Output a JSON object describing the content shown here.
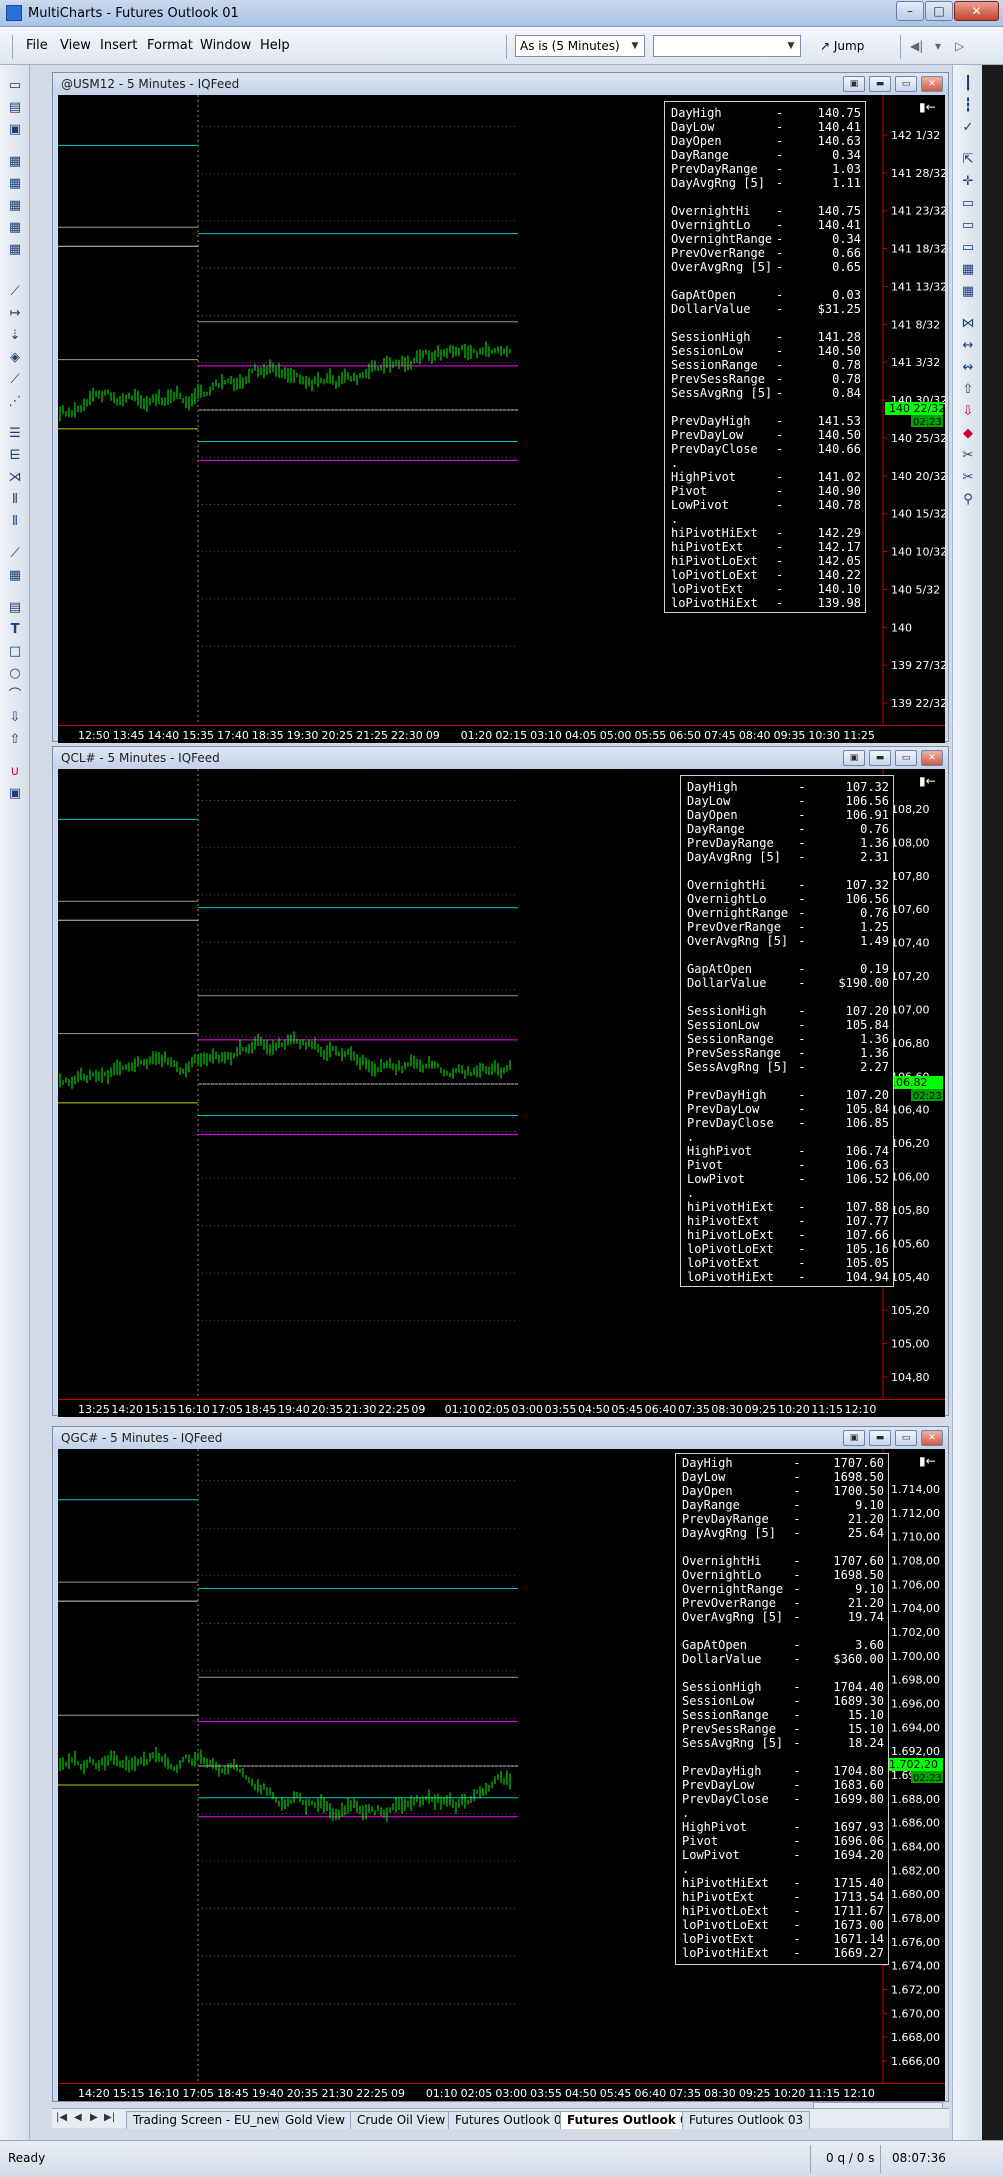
{
  "window": {
    "title": "MultiCharts - Futures Outlook 01",
    "buttons": {
      "minimize": "–",
      "maximize": "□",
      "close": "✕"
    }
  },
  "menu": [
    "File",
    "View",
    "Insert",
    "Format",
    "Window",
    "Help"
  ],
  "toolbar": {
    "resolution": "As is (5 Minutes)",
    "search_value": "",
    "jump_label": "Jump"
  },
  "colors": {
    "background": "#000000",
    "price": "#00ff00",
    "session": "#00c8c8",
    "pivot": "#ff00ff",
    "current_price_bg": "#00ff00"
  },
  "charts": [
    {
      "title": "@USM12 - 5 Minutes - IQFeed",
      "current_price": "140 22/32",
      "countdown": "02:23",
      "price_labels": [
        "142 1/32",
        "141 28/32",
        "141 23/32",
        "141 18/32",
        "141 13/32",
        "141 8/32",
        "141 3/32",
        "140 30/32",
        "140 25/32",
        "140 20/32",
        "140 15/32",
        "140 10/32",
        "140 5/32",
        "140",
        "139 27/32",
        "139 22/32"
      ],
      "time_labels": [
        "12:50",
        "13:45",
        "14:40",
        "15:35",
        "17:40",
        "18:35",
        "19:30",
        "20:25",
        "21:25",
        "22:30",
        "09",
        "01:20",
        "02:15",
        "03:10",
        "04:05",
        "05:00",
        "05:55",
        "06:50",
        "07:45",
        "08:40",
        "09:35",
        "10:30",
        "11:25"
      ],
      "stats": [
        [
          "DayHigh",
          "-",
          "140.75"
        ],
        [
          "DayLow",
          "-",
          "140.41"
        ],
        [
          "DayOpen",
          "-",
          "140.63"
        ],
        [
          "DayRange",
          "-",
          "0.34"
        ],
        [
          "PrevDayRange",
          "-",
          "1.03"
        ],
        [
          "DayAvgRng [5]",
          "-",
          "1.11"
        ],
        [
          "",
          "",
          ""
        ],
        [
          "OvernightHi",
          "-",
          "140.75"
        ],
        [
          "OvernightLo",
          "-",
          "140.41"
        ],
        [
          "OvernightRange",
          "-",
          "0.34"
        ],
        [
          "PrevOverRange",
          "-",
          "0.66"
        ],
        [
          "OverAvgRng [5]",
          "-",
          "0.65"
        ],
        [
          "",
          "",
          ""
        ],
        [
          "GapAtOpen",
          "-",
          "0.03"
        ],
        [
          "DollarValue",
          "-",
          "$31.25"
        ],
        [
          "",
          "",
          ""
        ],
        [
          "SessionHigh",
          "-",
          "141.28"
        ],
        [
          "SessionLow",
          "-",
          "140.50"
        ],
        [
          "SessionRange",
          "-",
          "0.78"
        ],
        [
          "PrevSessRange",
          "-",
          "0.78"
        ],
        [
          "SessAvgRng [5]",
          "-",
          "0.84"
        ],
        [
          "",
          "",
          ""
        ],
        [
          "PrevDayHigh",
          "-",
          "141.53"
        ],
        [
          "PrevDayLow",
          "-",
          "140.50"
        ],
        [
          "PrevDayClose",
          "-",
          "140.66"
        ],
        [
          ".",
          "",
          ""
        ],
        [
          "HighPivot",
          "-",
          "141.02"
        ],
        [
          "Pivot",
          "-",
          "140.90"
        ],
        [
          "LowPivot",
          "-",
          "140.78"
        ],
        [
          ".",
          "",
          ""
        ],
        [
          "hiPivotHiExt",
          "-",
          "142.29"
        ],
        [
          "hiPivotExt",
          "-",
          "142.17"
        ],
        [
          "hiPivotLoExt",
          "-",
          "142.05"
        ],
        [
          "loPivotLoExt",
          "-",
          "140.22"
        ],
        [
          "loPivotExt",
          "-",
          "140.10"
        ],
        [
          "loPivotHiExt",
          "-",
          "139.98"
        ]
      ]
    },
    {
      "title": "QCL# - 5 Minutes - IQFeed",
      "current_price": "106.82",
      "countdown": "02:23",
      "price_labels": [
        "108,20",
        "108,00",
        "107,80",
        "107,60",
        "107,40",
        "107,20",
        "107,00",
        "106,80",
        "106,60",
        "106,40",
        "106,20",
        "106,00",
        "105,80",
        "105,60",
        "105,40",
        "105,20",
        "105,00",
        "104,80"
      ],
      "time_labels": [
        "13:25",
        "14:20",
        "15:15",
        "16:10",
        "17:05",
        "18:45",
        "19:40",
        "20:35",
        "21:30",
        "22:25",
        "09",
        "01:10",
        "02:05",
        "03:00",
        "03:55",
        "04:50",
        "05:45",
        "06:40",
        "07:35",
        "08:30",
        "09:25",
        "10:20",
        "11:15",
        "12:10"
      ],
      "stats": [
        [
          "DayHigh",
          "-",
          "107.32"
        ],
        [
          "DayLow",
          "-",
          "106.56"
        ],
        [
          "DayOpen",
          "-",
          "106.91"
        ],
        [
          "DayRange",
          "-",
          "0.76"
        ],
        [
          "PrevDayRange",
          "-",
          "1.36"
        ],
        [
          "DayAvgRng [5]",
          "-",
          "2.31"
        ],
        [
          "",
          "",
          ""
        ],
        [
          "OvernightHi",
          "-",
          "107.32"
        ],
        [
          "OvernightLo",
          "-",
          "106.56"
        ],
        [
          "OvernightRange",
          "-",
          "0.76"
        ],
        [
          "PrevOverRange",
          "-",
          "1.25"
        ],
        [
          "OverAvgRng [5]",
          "-",
          "1.49"
        ],
        [
          "",
          "",
          ""
        ],
        [
          "GapAtOpen",
          "-",
          "0.19"
        ],
        [
          "DollarValue",
          "-",
          "$190.00"
        ],
        [
          "",
          "",
          ""
        ],
        [
          "SessionHigh",
          "-",
          "107.20"
        ],
        [
          "SessionLow",
          "-",
          "105.84"
        ],
        [
          "SessionRange",
          "-",
          "1.36"
        ],
        [
          "PrevSessRange",
          "-",
          "1.36"
        ],
        [
          "SessAvgRng [5]",
          "-",
          "2.27"
        ],
        [
          "",
          "",
          ""
        ],
        [
          "PrevDayHigh",
          "-",
          "107.20"
        ],
        [
          "PrevDayLow",
          "-",
          "105.84"
        ],
        [
          "PrevDayClose",
          "-",
          "106.85"
        ],
        [
          ".",
          "",
          ""
        ],
        [
          "HighPivot",
          "-",
          "106.74"
        ],
        [
          "Pivot",
          "-",
          "106.63"
        ],
        [
          "LowPivot",
          "-",
          "106.52"
        ],
        [
          ".",
          "",
          ""
        ],
        [
          "hiPivotHiExt",
          "-",
          "107.88"
        ],
        [
          "hiPivotExt",
          "-",
          "107.77"
        ],
        [
          "hiPivotLoExt",
          "-",
          "107.66"
        ],
        [
          "loPivotLoExt",
          "-",
          "105.16"
        ],
        [
          "loPivotExt",
          "-",
          "105.05"
        ],
        [
          "loPivotHiExt",
          "-",
          "104.94"
        ]
      ]
    },
    {
      "title": "QGC# - 5 Minutes - IQFeed",
      "current_price": "1.702,20",
      "countdown": "02:23",
      "price_labels": [
        "1.714,00",
        "1.712,00",
        "1.710,00",
        "1.708,00",
        "1.706,00",
        "1.704,00",
        "1.702,00",
        "1.700,00",
        "1.698,00",
        "1.696,00",
        "1.694,00",
        "1.692,00",
        "1.690,00",
        "1.688,00",
        "1.686,00",
        "1.684,00",
        "1.682,00",
        "1.680,00",
        "1.678,00",
        "1.676,00",
        "1.674,00",
        "1.672,00",
        "1.670,00",
        "1.668,00",
        "1.666,00"
      ],
      "time_labels": [
        "14:20",
        "15:15",
        "16:10",
        "17:05",
        "18:45",
        "19:40",
        "20:35",
        "21:30",
        "22:25",
        "09",
        "01:10",
        "02:05",
        "03:00",
        "03:55",
        "04:50",
        "05:45",
        "06:40",
        "07:35",
        "08:30",
        "09:25",
        "10:20",
        "11:15",
        "12:10"
      ],
      "stats": [
        [
          "DayHigh",
          "-",
          "1707.60"
        ],
        [
          "DayLow",
          "-",
          "1698.50"
        ],
        [
          "DayOpen",
          "-",
          "1700.50"
        ],
        [
          "DayRange",
          "-",
          "9.10"
        ],
        [
          "PrevDayRange",
          "-",
          "21.20"
        ],
        [
          "DayAvgRng [5]",
          "-",
          "25.64"
        ],
        [
          "",
          "",
          ""
        ],
        [
          "OvernightHi",
          "-",
          "1707.60"
        ],
        [
          "OvernightLo",
          "-",
          "1698.50"
        ],
        [
          "OvernightRange",
          "-",
          "9.10"
        ],
        [
          "PrevOverRange",
          "-",
          "21.20"
        ],
        [
          "OverAvgRng [5]",
          "-",
          "19.74"
        ],
        [
          "",
          "",
          ""
        ],
        [
          "GapAtOpen",
          "-",
          "3.60"
        ],
        [
          "DollarValue",
          "-",
          "$360.00"
        ],
        [
          "",
          "",
          ""
        ],
        [
          "SessionHigh",
          "-",
          "1704.40"
        ],
        [
          "SessionLow",
          "-",
          "1689.30"
        ],
        [
          "SessionRange",
          "-",
          "15.10"
        ],
        [
          "PrevSessRange",
          "-",
          "15.10"
        ],
        [
          "SessAvgRng [5]",
          "-",
          "18.24"
        ],
        [
          "",
          "",
          ""
        ],
        [
          "PrevDayHigh",
          "-",
          "1704.80"
        ],
        [
          "PrevDayLow",
          "-",
          "1683.60"
        ],
        [
          "PrevDayClose",
          "-",
          "1699.80"
        ],
        [
          ".",
          "",
          ""
        ],
        [
          "HighPivot",
          "-",
          "1697.93"
        ],
        [
          "Pivot",
          "-",
          "1696.06"
        ],
        [
          "LowPivot",
          "-",
          "1694.20"
        ],
        [
          ".",
          "",
          ""
        ],
        [
          "hiPivotHiExt",
          "-",
          "1715.40"
        ],
        [
          "hiPivotExt",
          "-",
          "1713.54"
        ],
        [
          "hiPivotLoExt",
          "-",
          "1711.67"
        ],
        [
          "loPivotLoExt",
          "-",
          "1673.00"
        ],
        [
          "loPivotExt",
          "-",
          "1671.14"
        ],
        [
          "loPivotHiExt",
          "-",
          "1669.27"
        ]
      ]
    }
  ],
  "tabs": [
    "Trading Screen - EU_new",
    "Gold View",
    "Crude Oil View",
    "Futures Outlook 01",
    "Futures Outlook 02",
    "Futures Outlook 03"
  ],
  "active_tab": 4,
  "status": {
    "left": "Ready",
    "queue": "0 q / 0 s",
    "time": "08:07:36"
  }
}
